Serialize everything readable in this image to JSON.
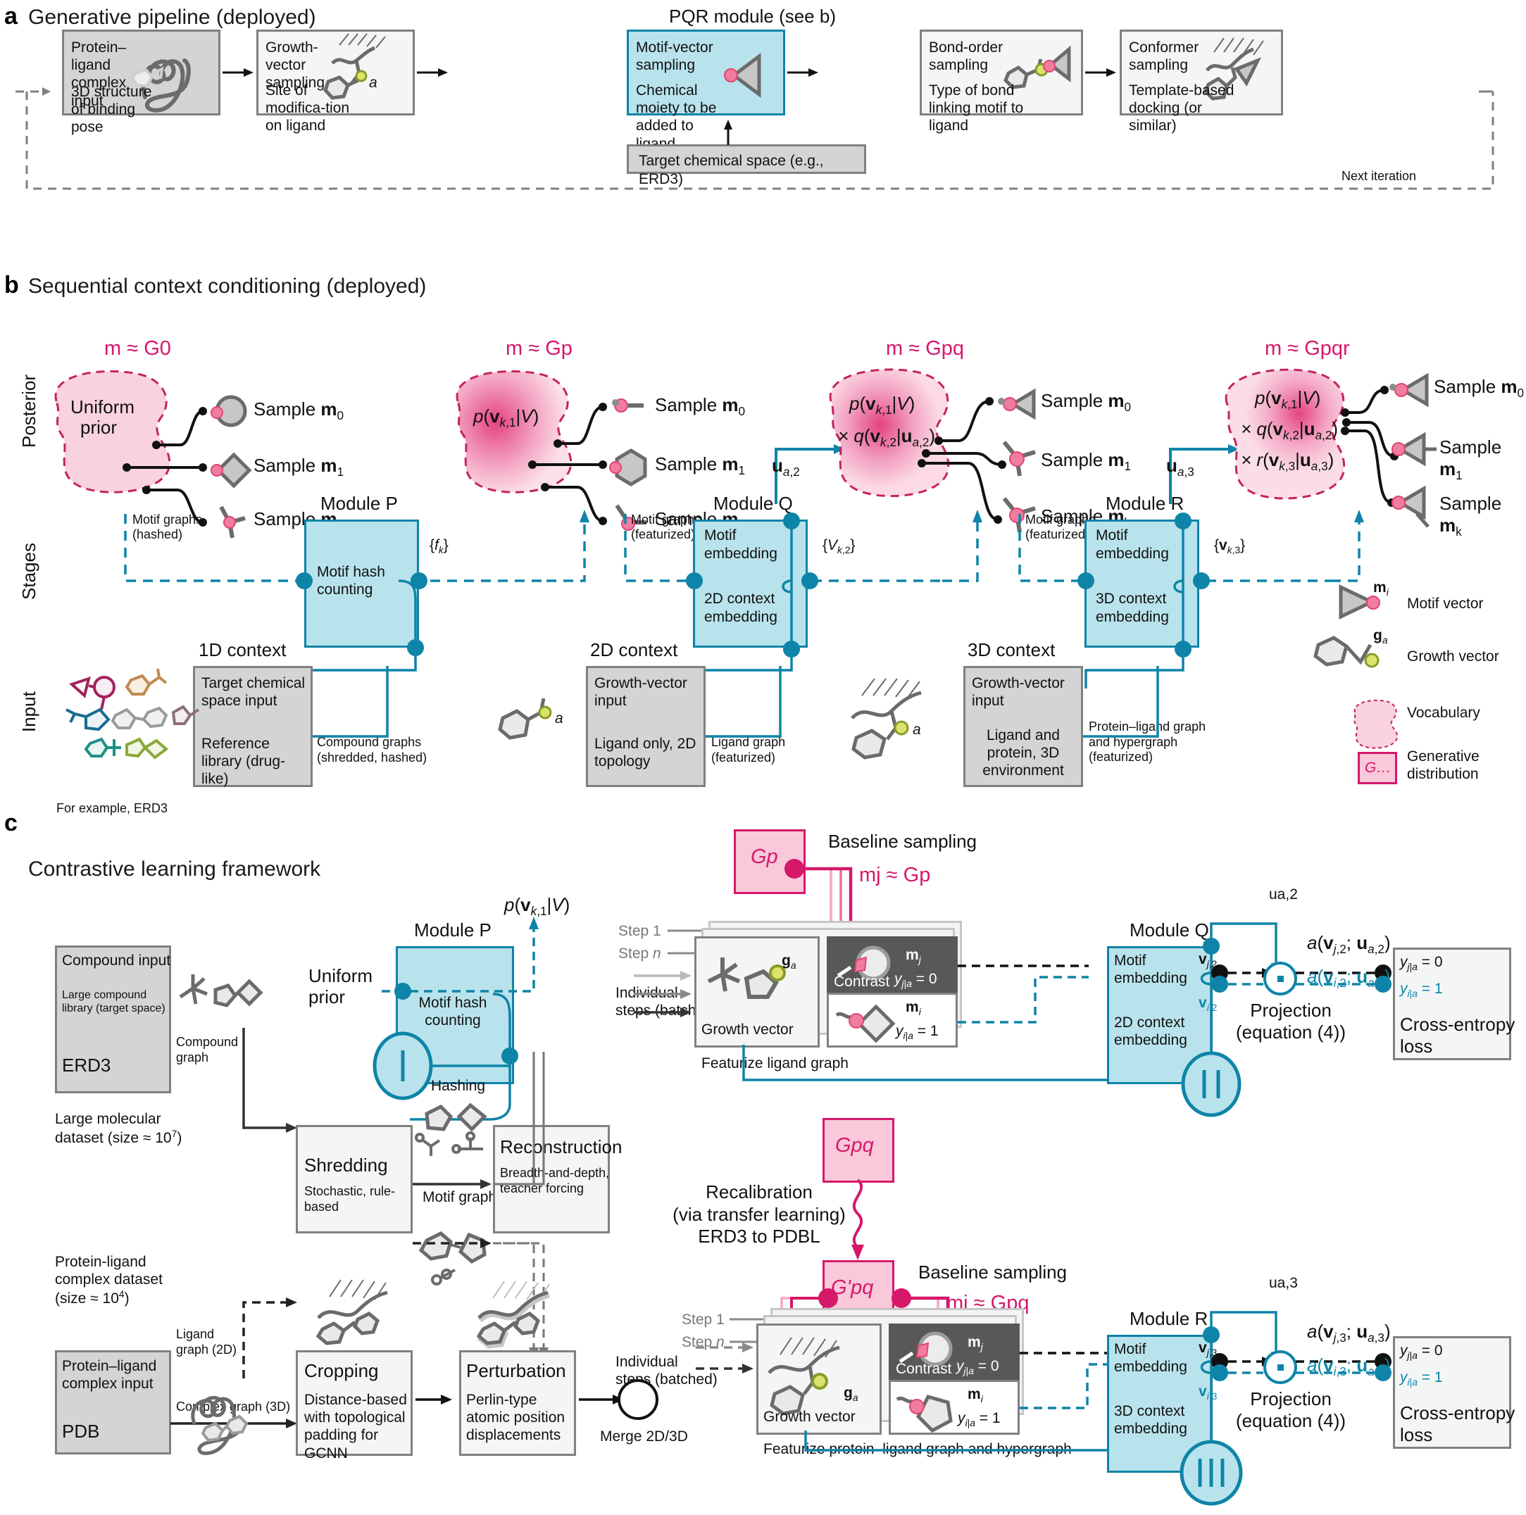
{
  "panels": {
    "a": {
      "letter": "a",
      "title": "Generative pipeline (deployed)",
      "pqr_label": "PQR module (see b)",
      "next_iteration": "Next iteration",
      "steps": [
        {
          "title": "Protein–ligand complex input",
          "sub": "3D structure of binding pose"
        },
        {
          "title": "Growth-vector sampling",
          "sub": "Site of modifica-tion on ligand",
          "atom": "a"
        },
        {
          "title": "Motif-vector sampling",
          "sub": "Chemical moiety to be added to ligand"
        },
        {
          "title": "Bond-order sampling",
          "sub": "Type of bond linking motif to ligand"
        },
        {
          "title": "Conformer sampling",
          "sub": "Template-based docking (or similar)"
        }
      ],
      "target_space": "Target chemical space (e.g., ERD3)"
    },
    "b": {
      "letter": "b",
      "title": "Sequential context conditioning (deployed)",
      "row_labels": {
        "posterior": "Posterior",
        "stages": "Stages",
        "input": "Input"
      },
      "posteriors": [
        {
          "approx": "m ≈ G0",
          "inside": [
            "Uniform",
            "prior"
          ],
          "samples": [
            "Sample m0",
            "Sample m1",
            "Sample mk"
          ]
        },
        {
          "approx": "m ≈ Gp",
          "inside": [
            "p(vk,1|V)"
          ],
          "samples": [
            "Sample m0",
            "Sample m1",
            "Sample mk"
          ]
        },
        {
          "approx": "m ≈ Gpq",
          "inside": [
            "p(vk,1|V)",
            "× q(vk,2|ua,2)"
          ],
          "samples": [
            "Sample m0",
            "Sample m1",
            "Sample mk"
          ]
        },
        {
          "approx": "m ≈ Gpqr",
          "inside": [
            "p(vk,1|V)",
            "× q(vk,2|ua,2)",
            "× r(vk,3|ua,3)"
          ],
          "samples": [
            "Sample m0",
            "Sample m1",
            "Sample mk"
          ]
        }
      ],
      "u_labels": [
        "ua,2",
        "ua,3"
      ],
      "modules": [
        {
          "name": "Module P",
          "lines": [
            "Motif hash",
            "counting"
          ],
          "out": "{fk}"
        },
        {
          "name": "Module Q",
          "lines": [
            "Motif",
            "embedding",
            "2D context",
            "embedding"
          ],
          "out": "{Vk,2}"
        },
        {
          "name": "Module R",
          "lines": [
            "Motif",
            "embedding",
            "3D context",
            "embedding"
          ],
          "out": "{vk,3}"
        }
      ],
      "stage_edges": [
        [
          "Motif graphs",
          "(hashed)"
        ],
        [
          "Motif graphs",
          "(featurized)"
        ],
        [
          "Motif graphs",
          "(featurized)"
        ]
      ],
      "contexts": [
        {
          "heading": "1D context",
          "title": "Target chemical space input",
          "sub": "Reference library (drug-like)",
          "edge": [
            "Compound graphs",
            "(shredded, hashed)"
          ],
          "note": "For example, ERD3"
        },
        {
          "heading": "2D context",
          "title": "Growth-vector input",
          "sub": "Ligand only, 2D topology",
          "edge": [
            "Ligand graph",
            "(featurized)"
          ],
          "atom": "a"
        },
        {
          "heading": "3D context",
          "title": "Growth-vector input",
          "sub": "Ligand and protein, 3D environment",
          "edge": [
            "Protein–ligand graph",
            "and hypergraph",
            "(featurized)"
          ],
          "atom": "a"
        }
      ],
      "legend": [
        {
          "symbol": "motif-vector-glyph",
          "tag": "mi",
          "label": "Motif vector"
        },
        {
          "symbol": "growth-vector-glyph",
          "tag": "ga",
          "label": "Growth vector"
        },
        {
          "symbol": "vocabulary-blob",
          "tag": "",
          "label": "Vocabulary"
        },
        {
          "symbol": "generative-square",
          "tag": "G…",
          "label": "Generative distribution"
        }
      ]
    },
    "c": {
      "letter": "c",
      "title": "Contrastive learning framework",
      "compound_input": {
        "title": "Compound input",
        "sub": "Large compound library (target space)",
        "db": "ERD3",
        "caption": [
          "Large molecular",
          "dataset (size ≈ 10",
          "7",
          ")"
        ],
        "edge": [
          "Compound",
          "graph"
        ]
      },
      "pdb_input": {
        "caption": [
          "Protein-ligand",
          "complex dataset",
          "(size ≈ 10",
          "4",
          ")"
        ],
        "title": "Protein–ligand complex input",
        "db": "PDB",
        "edge_2d": [
          "Ligand",
          "graph (2D)"
        ],
        "edge_3d": "Complex graph (3D)"
      },
      "module_p": {
        "name": "Module P",
        "lines": [
          "Motif hash",
          "counting"
        ],
        "prior": [
          "Uniform",
          "prior"
        ],
        "formula": "p(vk,1|V)",
        "badge": "I",
        "hashing": "Hashing"
      },
      "shredding": {
        "title": "Shredding",
        "sub": "Stochastic, rule-based",
        "edge": "Motif graphs"
      },
      "reconstruction": {
        "title": "Reconstruction",
        "sub": "Breadth-and-depth, teacher forcing"
      },
      "cropping": {
        "title": "Cropping",
        "sub": "Distance-based with topological padding for GCNN"
      },
      "perturbation": {
        "title": "Perturbation",
        "sub": "Perlin-type atomic position displacements"
      },
      "merge": "Merge 2D/3D",
      "individual_steps": [
        "Individual",
        "steps (batched)"
      ],
      "steps": [
        "Step 1",
        "Step n"
      ],
      "branches": [
        {
          "gen_box": "Gp",
          "baseline": "Baseline sampling",
          "approx": "mj ≈ Gp",
          "growth_label": "Growth vector",
          "growth_tag": "ga",
          "contrast_label": "Contrast",
          "neg": {
            "tag": "mj",
            "y": "yj|a = 0"
          },
          "pos": {
            "tag": "mi",
            "y": "yi|a = 1"
          },
          "featurize": "Featurize ligand graph",
          "module": {
            "name": "Module Q",
            "lines": [
              "Motif",
              "embedding",
              "2D context",
              "embedding"
            ],
            "badge": "II"
          },
          "u": "ua,2",
          "v_top": "vj,2",
          "v_bot": "vi,2",
          "proj": [
            "Projection",
            "(equation (4))"
          ],
          "a_top": "a(vj,2; ua,2)",
          "a_bot": "a(vi,2; ua,2)",
          "loss": {
            "y_top": "yj|a = 0",
            "y_bot": "yi|a = 1",
            "title": [
              "Cross-entropy",
              "loss"
            ]
          }
        },
        {
          "gen_box": "Gpq",
          "gen_box2": "G'pq",
          "recalibration": [
            "Recalibration",
            "(via transfer learning)",
            "ERD3 to PDBL"
          ],
          "baseline": "Baseline sampling",
          "approx": "mj ≈ Gpq",
          "growth_label": "Growth vector",
          "growth_tag": "ga",
          "contrast_label": "Contrast",
          "neg": {
            "tag": "mj",
            "y": "yj|a = 0"
          },
          "pos": {
            "tag": "mi",
            "y": "yi|a = 1"
          },
          "featurize": "Featurize protein–ligand graph and hypergraph",
          "module": {
            "name": "Module R",
            "lines": [
              "Motif",
              "embedding",
              "3D context",
              "embedding"
            ],
            "badge": "III"
          },
          "u": "ua,3",
          "v_top": "vj,3",
          "v_bot": "vi,3",
          "proj": [
            "Projection",
            "(equation (4))"
          ],
          "a_top": "a(vj,3; ua,3)",
          "a_bot": "a(vi,3; ua,3)",
          "loss": {
            "y_top": "yj|a = 0",
            "y_bot": "yi|a = 1",
            "title": [
              "Cross-entropy",
              "loss"
            ]
          }
        }
      ]
    }
  },
  "colors": {
    "teal": "#0e84a8",
    "pink": "#d6186a",
    "pink_light": "#f9c8d9",
    "gray_box": "#d4d4d4",
    "light_box": "#f4f6f5",
    "dark_box": "#585858",
    "mol_gray": "#6b6b6b",
    "green_atom": "#c6d84a"
  }
}
